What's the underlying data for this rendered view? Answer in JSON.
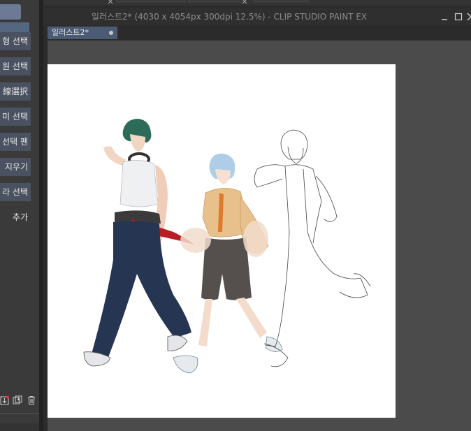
{
  "window": {
    "title": "일러스트2* (4030 x 4054px 300dpi 12.5%)  - CLIP STUDIO PAINT EX",
    "doc_tab": "일러스트2*"
  },
  "left_panel": {
    "tools": [
      {
        "label": "형 선택"
      },
      {
        "label": "원 선택"
      },
      {
        "label": "線選択"
      },
      {
        "label": "미 선택"
      },
      {
        "label": "선택 펜"
      },
      {
        "label": "지우기"
      },
      {
        "label": "라 선택"
      },
      {
        "label": "추가"
      }
    ]
  },
  "colors": {
    "panel_bg": "#3a3a3a",
    "accent": "#556680",
    "canvas_bg": "#4b4b4b",
    "paper": "#ffffff"
  },
  "icons": {
    "minimize": "minimize-icon",
    "maximize": "maximize-icon",
    "close": "close-icon",
    "new_layer_from": "import-layer-icon",
    "duplicate": "duplicate-layer-icon",
    "delete": "trash-icon"
  }
}
